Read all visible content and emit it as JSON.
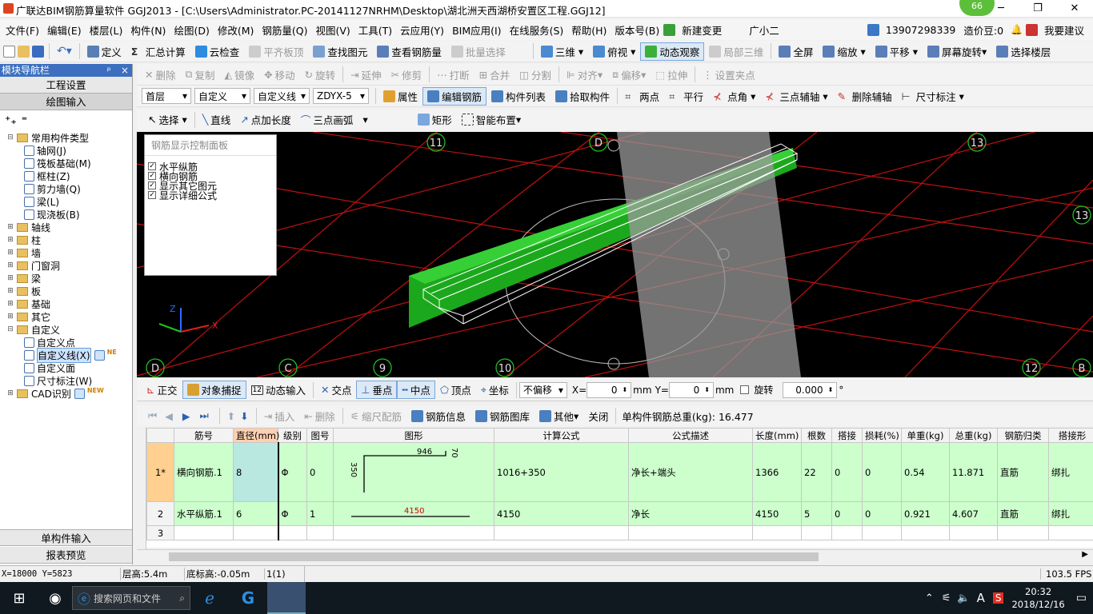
{
  "title": "广联达BIM钢筋算量软件 GGJ2013 - [C:\\Users\\Administrator.PC-20141127NRHM\\Desktop\\湖北洲天西湖桥安置区工程.GGJ12]",
  "badge": "66",
  "menu": [
    "文件(F)",
    "编辑(E)",
    "楼层(L)",
    "构件(N)",
    "绘图(D)",
    "修改(M)",
    "钢筋量(Q)",
    "视图(V)",
    "工具(T)",
    "云应用(Y)",
    "BIM应用(I)",
    "在线服务(S)",
    "帮助(H)",
    "版本号(B)",
    "新建变更",
    "广小二"
  ],
  "menu_right": {
    "phone": "13907298339",
    "cost_beans": "造价豆:0",
    "suggest": "我要建议"
  },
  "tb1": {
    "define": "定义",
    "sum": "汇总计算",
    "cloud_check": "云检查",
    "flat_board": "平齐板顶",
    "find": "查找图元",
    "view_rebar": "查看钢筋量",
    "batch": "批量选择",
    "view3d": "三维",
    "top_view": "俯视",
    "dynamic": "动态观察",
    "local3d": "局部三维",
    "fullscreen": "全屏",
    "zoom": "缩放",
    "pan": "平移",
    "rotate": "屏幕旋转",
    "select_floor": "选择楼层"
  },
  "tb2": [
    "删除",
    "复制",
    "镜像",
    "移动",
    "旋转",
    "延伸",
    "修剪",
    "打断",
    "合并",
    "分割",
    "对齐",
    "偏移",
    "拉伸",
    "设置夹点"
  ],
  "tb3": {
    "floor": "首层",
    "cat": "自定义",
    "type": "自定义线",
    "name": "ZDYX-5",
    "attr": "属性",
    "edit_rebar": "编辑钢筋",
    "list": "构件列表",
    "pick": "拾取构件",
    "two_pt": "两点",
    "parallel": "平行",
    "pt_angle": "点角",
    "three_axis": "三点辅轴",
    "del_axis": "删除辅轴",
    "dim": "尺寸标注"
  },
  "tb4": {
    "select": "选择",
    "line": "直线",
    "pt_len": "点加长度",
    "arc": "三点画弧",
    "rect": "矩形",
    "smart": "智能布置"
  },
  "nav": {
    "header": "模块导航栏",
    "pin": "ᵖ",
    "close": "×",
    "proj": "工程设置",
    "draw": "绘图输入",
    "single": "单构件输入",
    "report": "报表预览"
  },
  "tree": [
    {
      "label": "常用构件类型",
      "lvl": 0,
      "kind": "folder",
      "exp": "⊟"
    },
    {
      "label": "轴网(J)",
      "lvl": 1,
      "kind": "leaf"
    },
    {
      "label": "筏板基础(M)",
      "lvl": 1,
      "kind": "leaf"
    },
    {
      "label": "框柱(Z)",
      "lvl": 1,
      "kind": "leaf"
    },
    {
      "label": "剪力墙(Q)",
      "lvl": 1,
      "kind": "leaf"
    },
    {
      "label": "梁(L)",
      "lvl": 1,
      "kind": "leaf"
    },
    {
      "label": "现浇板(B)",
      "lvl": 1,
      "kind": "leaf"
    },
    {
      "label": "轴线",
      "lvl": 0,
      "kind": "folder",
      "exp": "⊞"
    },
    {
      "label": "柱",
      "lvl": 0,
      "kind": "folder",
      "exp": "⊞"
    },
    {
      "label": "墙",
      "lvl": 0,
      "kind": "folder",
      "exp": "⊞"
    },
    {
      "label": "门窗洞",
      "lvl": 0,
      "kind": "folder",
      "exp": "⊞"
    },
    {
      "label": "梁",
      "lvl": 0,
      "kind": "folder",
      "exp": "⊞"
    },
    {
      "label": "板",
      "lvl": 0,
      "kind": "folder",
      "exp": "⊞"
    },
    {
      "label": "基础",
      "lvl": 0,
      "kind": "folder",
      "exp": "⊞"
    },
    {
      "label": "其它",
      "lvl": 0,
      "kind": "folder",
      "exp": "⊞"
    },
    {
      "label": "自定义",
      "lvl": 0,
      "kind": "folder",
      "exp": "⊟"
    },
    {
      "label": "自定义点",
      "lvl": 1,
      "kind": "leaf"
    },
    {
      "label": "自定义线(X)",
      "lvl": 1,
      "kind": "leaf",
      "sel": true,
      "new": "NE"
    },
    {
      "label": "自定义面",
      "lvl": 1,
      "kind": "leaf"
    },
    {
      "label": "尺寸标注(W)",
      "lvl": 1,
      "kind": "leaf"
    },
    {
      "label": "CAD识别",
      "lvl": 0,
      "kind": "folder",
      "exp": "⊞",
      "new": "NEW"
    }
  ],
  "ctrlpanel": {
    "title": "钢筋显示控制面板",
    "items": [
      "水平纵筋",
      "横向钢筋",
      "显示其它图元",
      "显示详细公式"
    ]
  },
  "axis_labels": [
    {
      "t": "11"
    },
    {
      "t": "D"
    },
    {
      "t": "13"
    },
    {
      "t": "13"
    },
    {
      "t": "D"
    },
    {
      "t": "C"
    },
    {
      "t": "9"
    },
    {
      "t": "10"
    },
    {
      "t": "12"
    },
    {
      "t": "B"
    }
  ],
  "snap": {
    "ortho": "正交",
    "snap": "对象捕捉",
    "dyn": "动态输入",
    "inter": "交点",
    "perp": "垂点",
    "mid": "中点",
    "vertex": "顶点",
    "coord": "坐标",
    "offset": "不偏移",
    "x_label": "X=",
    "x": "0",
    "mm1": "mm",
    "y_label": "Y=",
    "y": "0",
    "mm2": "mm",
    "rot": "旋转",
    "rot_val": "0.000",
    "deg": "°"
  },
  "gridtb": {
    "insert": "插入",
    "del": "删除",
    "scale": "缩尺配筋",
    "info": "钢筋信息",
    "lib": "钢筋图库",
    "other": "其他",
    "close": "关闭",
    "total": "单构件钢筋总重(kg): 16.477"
  },
  "grid": {
    "headers": [
      "筋号",
      "直径(mm)",
      "级别",
      "图号",
      "图形",
      "计算公式",
      "公式描述",
      "长度(mm)",
      "根数",
      "搭接",
      "损耗(%)",
      "单重(kg)",
      "总重(kg)",
      "钢筋归类",
      "搭接形"
    ],
    "rows": [
      {
        "no": "1*",
        "name": "横向钢筋.1",
        "dia": "8",
        "grade": "Φ",
        "fig": "0",
        "shape": {
          "a": "350",
          "b": "946",
          "c": "70"
        },
        "formula": "1016+350",
        "desc": "净长+端头",
        "len": "1366",
        "cnt": "22",
        "lap": "0",
        "loss": "0",
        "unit": "0.54",
        "total": "11.871",
        "cls": "直筋",
        "laptype": "绑扎"
      },
      {
        "no": "2",
        "name": "水平纵筋.1",
        "dia": "6",
        "grade": "Φ",
        "fig": "1",
        "shape": {
          "a": "4150"
        },
        "formula": "4150",
        "desc": "净长",
        "len": "4150",
        "cnt": "5",
        "lap": "0",
        "loss": "0",
        "unit": "0.921",
        "total": "4.607",
        "cls": "直筋",
        "laptype": "绑扎"
      },
      {
        "no": "3"
      }
    ]
  },
  "status": {
    "coord": "X=18000 Y=5823",
    "floor_h": "层高:5.4m",
    "base_h": "底标高:-0.05m",
    "count": "1(1)",
    "fps": "103.5 FPS"
  },
  "taskbar": {
    "search": "搜索网页和文件",
    "time": "20:32",
    "date": "2018/12/16",
    "ime": "A"
  },
  "colors": {
    "title_blue": "#3c6fbf",
    "green": "#00c000",
    "red": "#d00000",
    "row_green": "#ccffcc"
  }
}
